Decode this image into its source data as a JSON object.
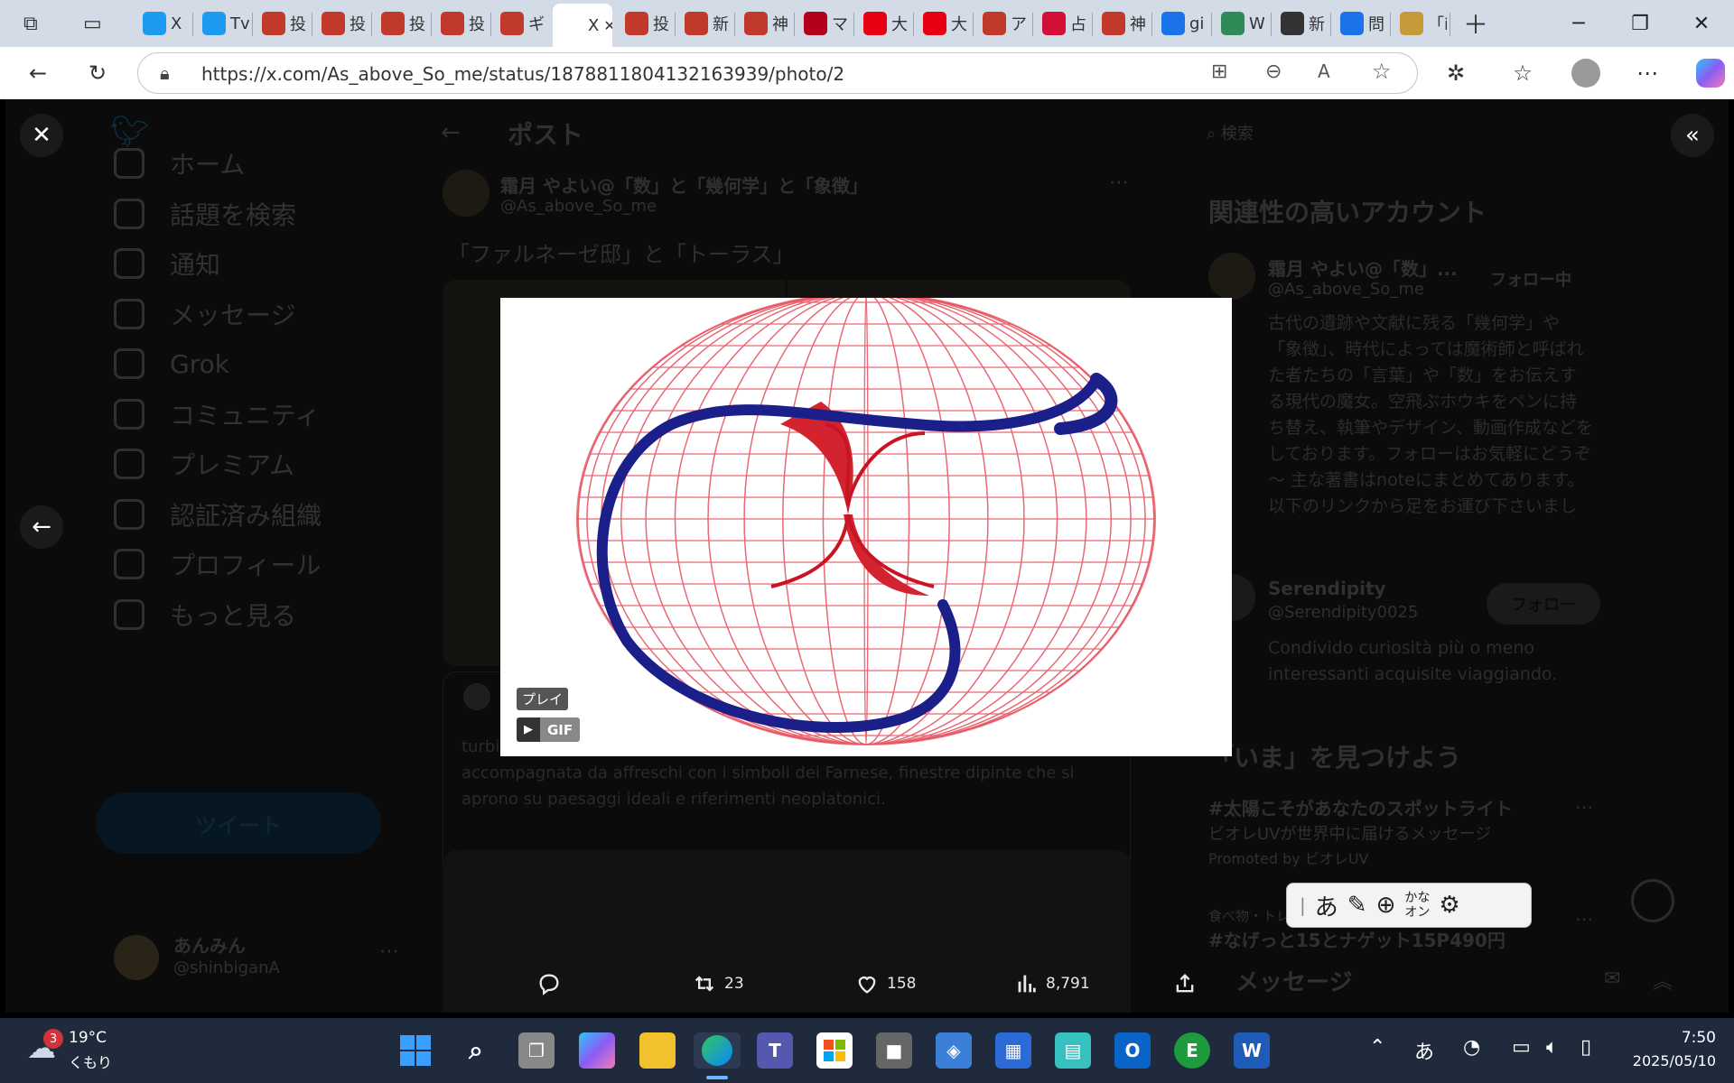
{
  "tabs": [
    {
      "title": "X"
    },
    {
      "title": "Tv"
    },
    {
      "title": "投"
    },
    {
      "title": "投"
    },
    {
      "title": "投"
    },
    {
      "title": "投"
    },
    {
      "title": "ギ"
    },
    {
      "title": "X",
      "active": true
    },
    {
      "title": "投"
    },
    {
      "title": "新"
    },
    {
      "title": "神"
    },
    {
      "title": "マ"
    },
    {
      "title": "大"
    },
    {
      "title": "大"
    },
    {
      "title": "ア"
    },
    {
      "title": "占"
    },
    {
      "title": "神"
    },
    {
      "title": "gi"
    },
    {
      "title": "W"
    },
    {
      "title": "新"
    },
    {
      "title": "問"
    },
    {
      "title": "「i"
    }
  ],
  "address": {
    "url": "https://x.com/As_above_So_me/status/1878811804132163939/photo/2"
  },
  "sidebar": {
    "items": [
      {
        "label": "ホーム"
      },
      {
        "label": "話題を検索"
      },
      {
        "label": "通知"
      },
      {
        "label": "メッセージ"
      },
      {
        "label": "Grok"
      },
      {
        "label": "コミュニティ"
      },
      {
        "label": "プレミアム"
      },
      {
        "label": "認証済み組織"
      },
      {
        "label": "プロフィール"
      },
      {
        "label": "もっと見る"
      }
    ],
    "tweet_button": "ツイート",
    "account_name": "あんみん",
    "account_handle": "@shinbiganA"
  },
  "post": {
    "header": "ポスト",
    "author_name": "霜月 やよい@「数」と「幾何学」と「象徴」",
    "author_handle": "@As_above_So_me",
    "text": "「ファルネーゼ邸」と「トーラス」",
    "quoted_text": "turbinio davvero emozionante,la scala fa tre giri completi,un ascesa accompagnata da affreschi con i simboli dei Farnese, finestre dipinte che si aprono su paesaggi ideali e riferimenti neoplatonici."
  },
  "right": {
    "search_placeholder": "検索",
    "related_title": "関連性の高いアカウント",
    "acc1_name": "霜月 やよい@「数」...",
    "acc1_handle": "@As_above_So_me",
    "acc1_button": "フォロー中",
    "acc1_bio": "古代の遺跡や文献に残る「幾何学」や「象徴」、時代によっては魔術師と呼ばれた者たちの「言葉」や「数」をお伝えする現代の魔女。空飛ぶホウキをペンに持ち替え、執筆やデザイン、動画作成などをしております。フォローはお気軽にどうぞ～ 主な著書はnoteにまとめてあります。以下のリンクから足をお運び下さいまし",
    "acc2_name": "Serendipity",
    "acc2_handle": "@Serendipity0025",
    "acc2_button": "フォロー",
    "acc2_bio": "Condivido curiosità più o meno interessanti acquisite viaggiando.",
    "trends_title": "「いま」を見つけよう",
    "trend1": "#太陽こそがあなたのスポットライト",
    "trend1_sub": "ビオレUVが世界中に届けるメッセージ",
    "trend1_promo": "Promoted by ビオレUV",
    "trend2_cat": "食べ物・トレンド",
    "trend2": "#なげっと15とナゲット15P490円",
    "messages": "メッセージ"
  },
  "media": {
    "play_label": "プレイ",
    "gif_label": "GIF"
  },
  "actions": {
    "reposts": "23",
    "likes": "158",
    "views": "8,791"
  },
  "ime": {
    "hiragana": "あ",
    "kana_top": "かな",
    "kana_bottom": "オン"
  },
  "taskbar": {
    "weather_temp": "19°C",
    "weather_desc": "くもり",
    "weather_badge": "3",
    "ime_indicator": "あ",
    "time": "7:50",
    "date": "2025/05/10"
  }
}
